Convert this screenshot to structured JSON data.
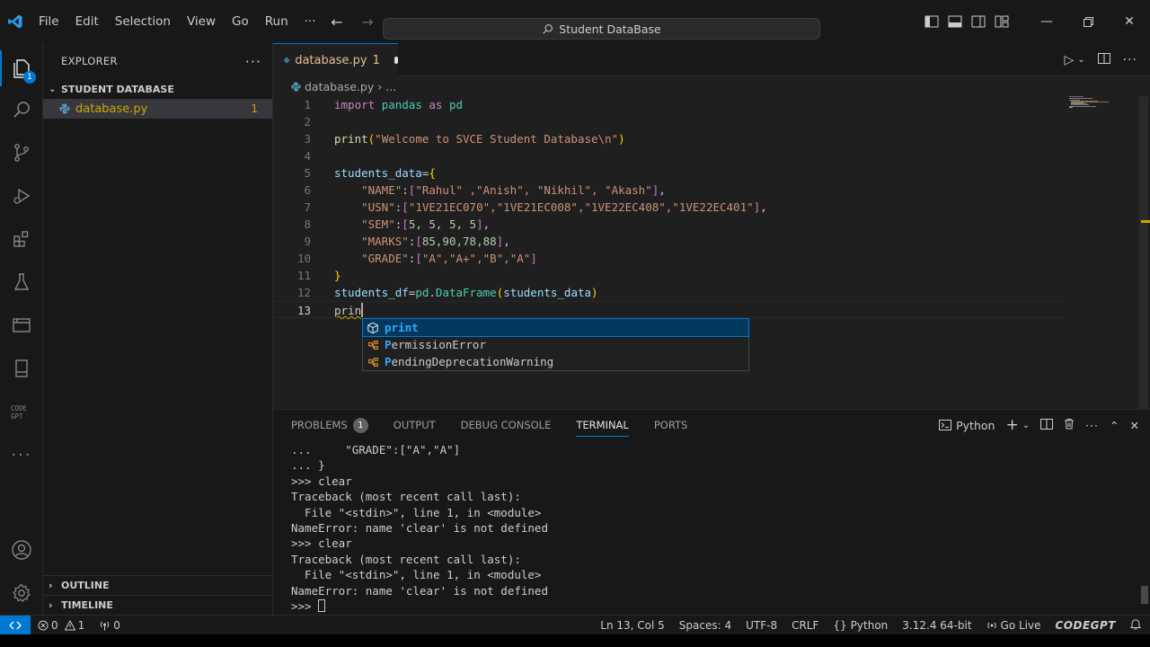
{
  "titlebar": {
    "menu": [
      "File",
      "Edit",
      "Selection",
      "View",
      "Go",
      "Run",
      "···"
    ],
    "search_text": "Student DataBase"
  },
  "activity": {
    "explorer_badge": "1"
  },
  "sidebar": {
    "title": "EXPLORER",
    "folder": "STUDENT DATABASE",
    "file": "database.py",
    "file_problems": "1",
    "outline": "OUTLINE",
    "timeline": "TIMELINE"
  },
  "editor": {
    "tab_label": "database.py",
    "tab_problems": "1",
    "breadcrumb_file": "database.py",
    "breadcrumb_more": "...",
    "line_numbers": [
      "1",
      "2",
      "3",
      "4",
      "5",
      "6",
      "7",
      "8",
      "9",
      "10",
      "11",
      "12",
      "13"
    ],
    "code": {
      "l1_kw1": "import",
      "l1_mod": "pandas",
      "l1_kw2": "as",
      "l1_alias": "pd",
      "l3_fn": "print",
      "l3_str": "\"Welcome to SVCE Student Database\\n\"",
      "l5_var": "students_data",
      "l6_key": "\"NAME\"",
      "l6_vals": "\"Rahul\" ,\"Anish\", \"Nikhil\", \"Akash\"",
      "l7_key": "\"USN\"",
      "l7_vals": "\"1VE21EC070\",\"1VE21EC008\",\"1VE22EC408\",\"1VE22EC401\"",
      "l8_key": "\"SEM\"",
      "l8_vals": "5, 5, 5, 5",
      "l9_key": "\"MARKS\"",
      "l9_vals": "85,90,78,88",
      "l10_key": "\"GRADE\"",
      "l10_vals": "\"A\",\"A+\",\"B\",\"A\"",
      "l12_var": "students_df",
      "l12_mod": "pd",
      "l12_cls": "DataFrame",
      "l12_arg": "students_data",
      "l13_typed": "prin"
    }
  },
  "suggest": {
    "items": [
      {
        "pre": "",
        "hl": "print",
        "post": ""
      },
      {
        "pre": "",
        "hl": "P",
        "post": "ermissionError"
      },
      {
        "pre": "",
        "hl": "P",
        "post": "endingDeprecationWarning"
      }
    ]
  },
  "panel": {
    "tabs": [
      "PROBLEMS",
      "OUTPUT",
      "DEBUG CONSOLE",
      "TERMINAL",
      "PORTS"
    ],
    "problems_count": "1",
    "shell": "Python",
    "terminal_lines": [
      "...     \"GRADE\":[\"A\",\"A\"]",
      "... }",
      ">>> clear",
      "Traceback (most recent call last):",
      "  File \"<stdin>\", line 1, in <module>",
      "NameError: name 'clear' is not defined",
      ">>> clear",
      "Traceback (most recent call last):",
      "  File \"<stdin>\", line 1, in <module>",
      "NameError: name 'clear' is not defined",
      ">>> "
    ]
  },
  "statusbar": {
    "errors": "0",
    "warnings": "1",
    "ports": "0",
    "position": "Ln 13, Col 5",
    "spaces": "Spaces: 4",
    "encoding": "UTF-8",
    "eol": "CRLF",
    "language": "Python",
    "interpreter": "3.12.4 64-bit",
    "golive": "Go Live",
    "codegpt": "CODEGPT"
  },
  "colors": {
    "accent": "#0078d4",
    "warning": "#cca700"
  }
}
